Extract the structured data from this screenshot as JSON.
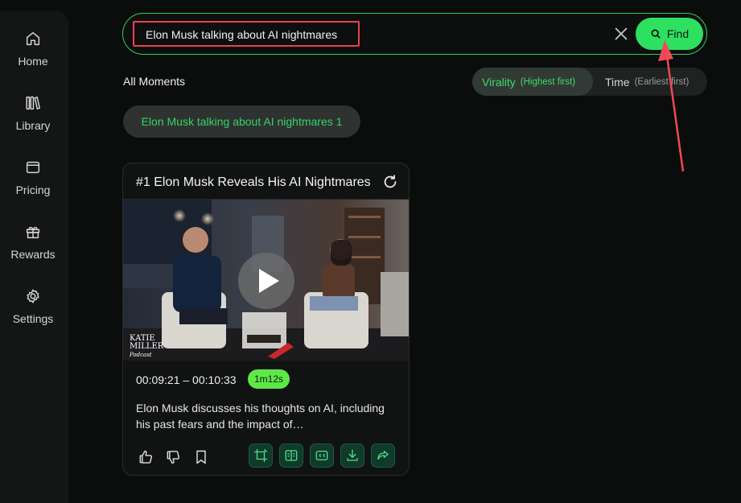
{
  "sidebar": {
    "items": [
      {
        "label": "Home",
        "icon": "home-icon"
      },
      {
        "label": "Library",
        "icon": "library-icon"
      },
      {
        "label": "Pricing",
        "icon": "wallet-icon"
      },
      {
        "label": "Rewards",
        "icon": "gift-icon"
      },
      {
        "label": "Settings",
        "icon": "gear-icon"
      }
    ]
  },
  "search": {
    "query": "Elon Musk talking about AI nightmares",
    "find_label": "Find"
  },
  "moments": {
    "heading": "All Moments",
    "sort": {
      "active": {
        "label": "Virality",
        "sub": "(Highest first)"
      },
      "inactive": {
        "label": "Time",
        "sub": "(Earliest first)"
      }
    },
    "query_chip": "Elon Musk talking about AI nightmares 1"
  },
  "card": {
    "title": "#1 Elon Musk Reveals His AI Nightmares",
    "time_range": "00:09:21 – 00:10:33",
    "duration": "1m12s",
    "description": "Elon Musk discusses his thoughts on AI, including his past fears and the impact of…",
    "watermark": {
      "line1": "KATIE",
      "line2": "MILLER",
      "line3": "Podcast"
    }
  },
  "colors": {
    "accent": "#2ee05f",
    "highlight_box": "#e8424e",
    "background": "#0b0c0c"
  }
}
